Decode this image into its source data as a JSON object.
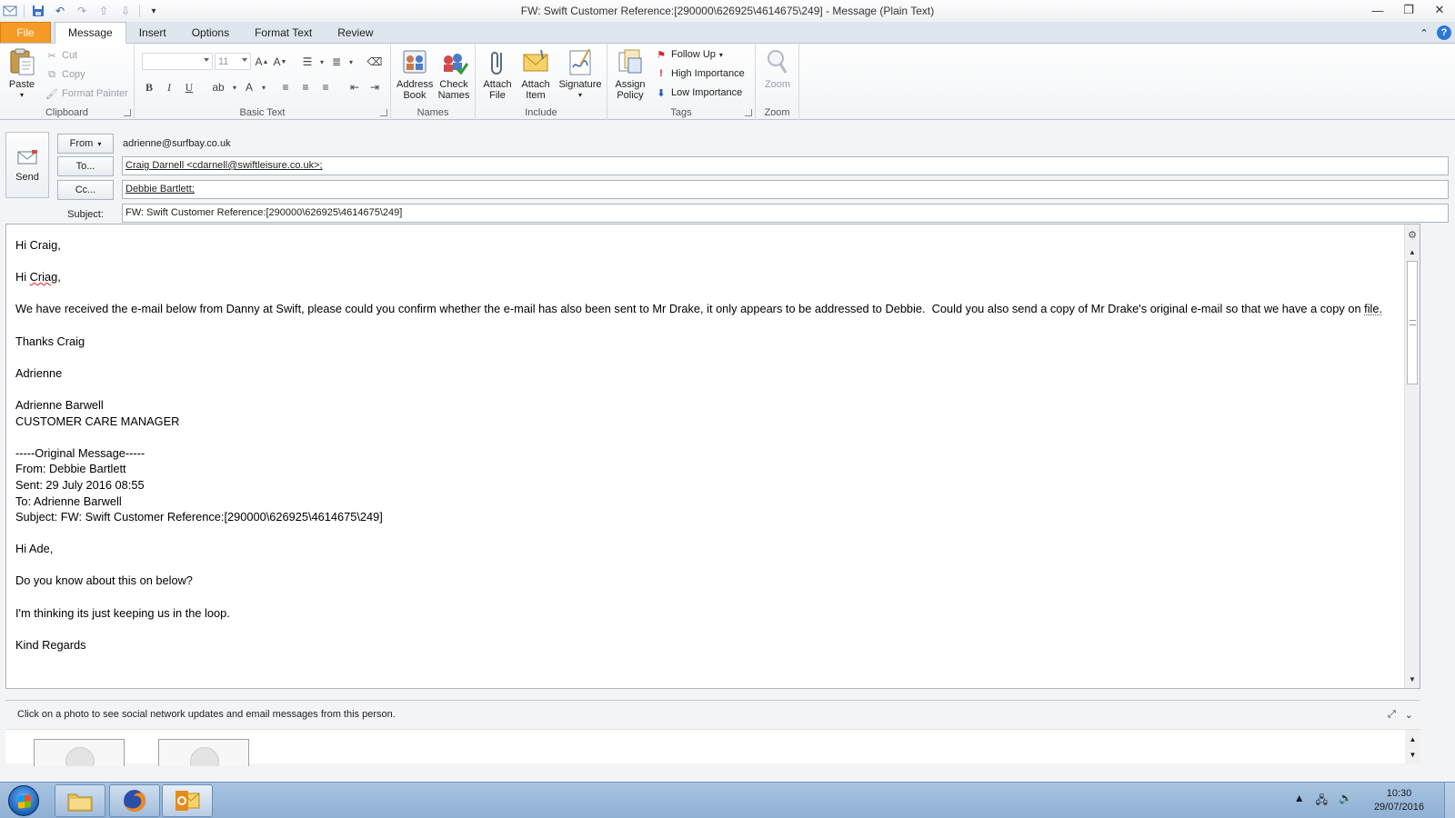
{
  "window": {
    "title": "FW: Swift Customer Reference:[290000\\626925\\4614675\\249]  -  Message (Plain Text)"
  },
  "tabs": [
    {
      "label": "File"
    },
    {
      "label": "Message"
    },
    {
      "label": "Insert"
    },
    {
      "label": "Options"
    },
    {
      "label": "Format Text"
    },
    {
      "label": "Review"
    }
  ],
  "ribbon": {
    "clipboard": {
      "label": "Clipboard",
      "paste": "Paste",
      "cut": "Cut",
      "copy": "Copy",
      "format_painter": "Format Painter"
    },
    "basic_text": {
      "label": "Basic Text",
      "font_size": "11"
    },
    "names": {
      "label": "Names",
      "address_book": "Address Book",
      "check_names": "Check Names"
    },
    "include": {
      "label": "Include",
      "attach_file": "Attach File",
      "attach_item": "Attach Item",
      "signature": "Signature"
    },
    "tags": {
      "label": "Tags",
      "assign_policy": "Assign Policy",
      "follow_up": "Follow Up",
      "high_importance": "High Importance",
      "low_importance": "Low Importance"
    },
    "zoom": {
      "label": "Zoom",
      "zoom": "Zoom"
    }
  },
  "compose": {
    "send": "Send",
    "from_button": "From",
    "from_value": "adrienne@surfbay.co.uk",
    "to_button": "To...",
    "to_value": "Craig Darnell <cdarnell@swiftleisure.co.uk>;",
    "cc_button": "Cc...",
    "cc_value": "Debbie Bartlett;",
    "subject_label": "Subject:",
    "subject_value": "FW: Swift Customer Reference:[290000\\626925\\4614675\\249]"
  },
  "body": {
    "line1": "Hi Craig,",
    "line2_a": "Hi ",
    "line2_b": "Criag",
    "line2_c": ",",
    "line3_a": "We have received the e-mail below from Danny at Swift, please could you confirm whether the e-mail has also been sent to Mr Drake, it only appears to be addressed to Debbie.  Could you also send a copy of Mr Drake's original e-mail so that we have a copy on ",
    "line3_b": "file.",
    "line4": "Thanks Craig",
    "line5": "Adrienne",
    "sig_name": "Adrienne Barwell",
    "sig_title": "CUSTOMER CARE MANAGER",
    "orig_header": "-----Original Message-----",
    "orig_from": "From: Debbie Bartlett",
    "orig_sent": "Sent: 29 July 2016 08:55",
    "orig_to": "To: Adrienne Barwell",
    "orig_subject": "Subject: FW: Swift Customer Reference:[290000\\626925\\4614675\\249]",
    "line6": "Hi Ade,",
    "line7": "Do you know about this on below?",
    "line8": "I'm thinking its just keeping us in the loop.",
    "line9": "Kind Regards"
  },
  "people_pane": {
    "hint": "Click on a photo to see social network updates and email messages from this person."
  },
  "taskbar": {
    "time": "10:30",
    "date": "29/07/2016"
  }
}
